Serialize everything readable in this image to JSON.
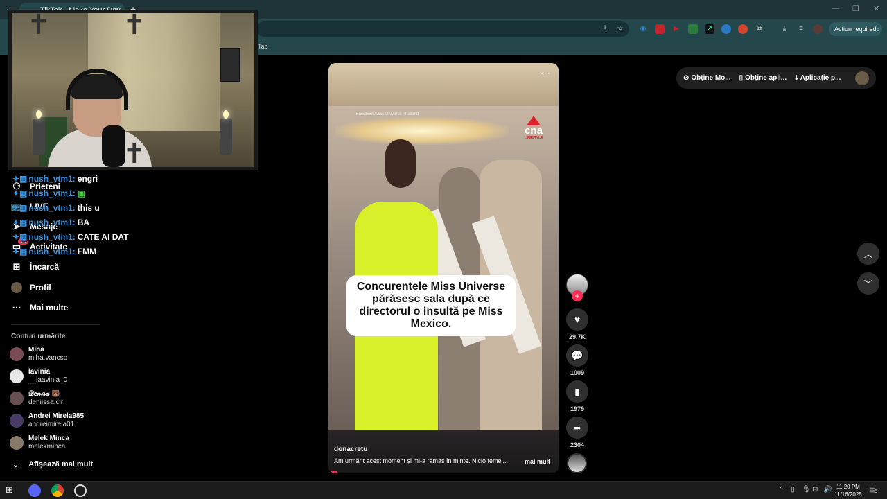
{
  "browser": {
    "tab_title": "TikTok - Make Your Day",
    "tab_close": "×",
    "new_tab": "+",
    "action_required": "Action required",
    "bookmark_label": "Tab",
    "window_minimize": "—",
    "window_restore": "❐",
    "window_close": "✕"
  },
  "chat": [
    {
      "user": "nush_vtm1:",
      "msg": "engri"
    },
    {
      "user": "nush_vtm1:",
      "msg": ""
    },
    {
      "user": "nush_vtm1:",
      "msg": "this u"
    },
    {
      "user": "nush_vtm1:",
      "msg": "BA"
    },
    {
      "user": "nush_vtm1:",
      "msg": "CATE AI DAT"
    },
    {
      "user": "nush_vtm1:",
      "msg": "FMM"
    }
  ],
  "sidebar": {
    "items": [
      {
        "label": "Prieteni",
        "icon": "friends-icon"
      },
      {
        "label": "LIVE",
        "icon": "live-icon"
      },
      {
        "label": "Mesaje",
        "icon": "messages-icon"
      },
      {
        "label": "Activitate",
        "icon": "activity-icon",
        "badge": "10"
      },
      {
        "label": "Încarcă",
        "icon": "upload-icon"
      },
      {
        "label": "Profil",
        "icon": "profile-icon"
      },
      {
        "label": "Mai multe",
        "icon": "more-icon"
      }
    ],
    "following_title": "Conturi urmărite",
    "accounts": [
      {
        "name": "Miha",
        "handle": "miha.vancso",
        "color": "#7a4a55"
      },
      {
        "name": "lavinia",
        "handle": "__laavinia_0",
        "color": "#e8e8e8"
      },
      {
        "name": "𝒟𝑒𝓃𝒾𝓈𝒶 🐻",
        "handle": "deniissa.clr",
        "color": "#6a4f52"
      },
      {
        "name": "Andrei Mirela985",
        "handle": "andreimirela01",
        "color": "#4a3b66"
      },
      {
        "name": "Melek Minca",
        "handle": "melekminca",
        "color": "#8a7a6a"
      }
    ],
    "show_more": "Afișează mai mult"
  },
  "video": {
    "credit": "Facebook/Miss Universe Thailand",
    "brand": "cna",
    "brand_sub": "LIFESTYLE",
    "caption": "Concurentele Miss Universe părăsesc sala după ce directorul o insultă pe Miss Mexico.",
    "username": "donacretu",
    "description": "Am urmărit acest moment și mi-a rămas în minte. Nicio femei...",
    "more_link": "mai mult",
    "progress": 0.035
  },
  "actions": {
    "likes": "29.7K",
    "comments": "1009",
    "saves": "1979",
    "shares": "2304"
  },
  "top_pills": [
    {
      "label": "Obține Mo...",
      "icon": "coin-icon"
    },
    {
      "label": "Obține apli...",
      "icon": "phone-icon"
    },
    {
      "label": "Aplicație p...",
      "icon": "download-icon"
    }
  ],
  "taskbar": {
    "time": "11:20 PM",
    "date": "11/16/2025",
    "notification_count": "5"
  },
  "colors": {
    "accent": "#fe2c55",
    "chat_user": "#3a8fd8",
    "chrome_bg": "#24474c"
  }
}
